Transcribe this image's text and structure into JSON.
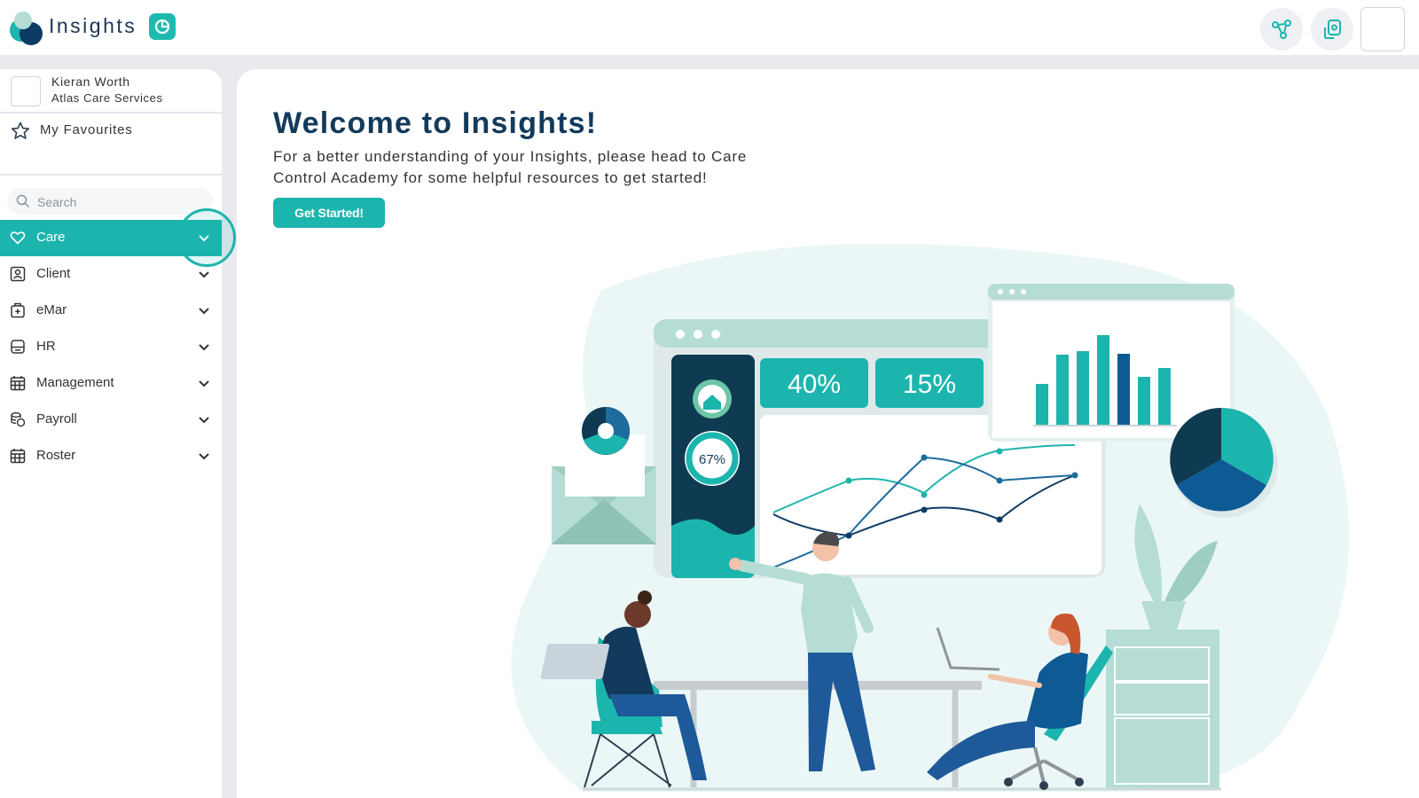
{
  "header": {
    "brand_name": "Insights",
    "icons": [
      "insights-logo",
      "insights-badge-icon",
      "share-network-icon",
      "device-link-icon"
    ]
  },
  "sidebar": {
    "user": {
      "name": "Kieran Worth",
      "organisation": "Atlas Care Services"
    },
    "favourites_label": "My Favourites",
    "search_placeholder": "Search",
    "items": [
      {
        "label": "Care",
        "icon": "heart-icon",
        "active": true
      },
      {
        "label": "Client",
        "icon": "client-icon",
        "active": false
      },
      {
        "label": "eMar",
        "icon": "medicine-icon",
        "active": false
      },
      {
        "label": "HR",
        "icon": "hr-icon",
        "active": false
      },
      {
        "label": "Management",
        "icon": "calendar-icon",
        "active": false
      },
      {
        "label": "Payroll",
        "icon": "coins-icon",
        "active": false
      },
      {
        "label": "Roster",
        "icon": "calendar-icon",
        "active": false
      }
    ]
  },
  "main": {
    "title": "Welcome to Insights!",
    "intro_line1": "For a better understanding of your Insights, please head to Care",
    "intro_line2": "Control Academy for some helpful resources to get started!",
    "cta_label": "Get Started!",
    "illustration": {
      "stat_1": "40%",
      "stat_2": "15%",
      "gauge": "67%"
    }
  },
  "colors": {
    "accent": "#1cb5ad",
    "navy": "#123a5c",
    "mint": "#b5ddd5",
    "background": "#e8eaee"
  }
}
